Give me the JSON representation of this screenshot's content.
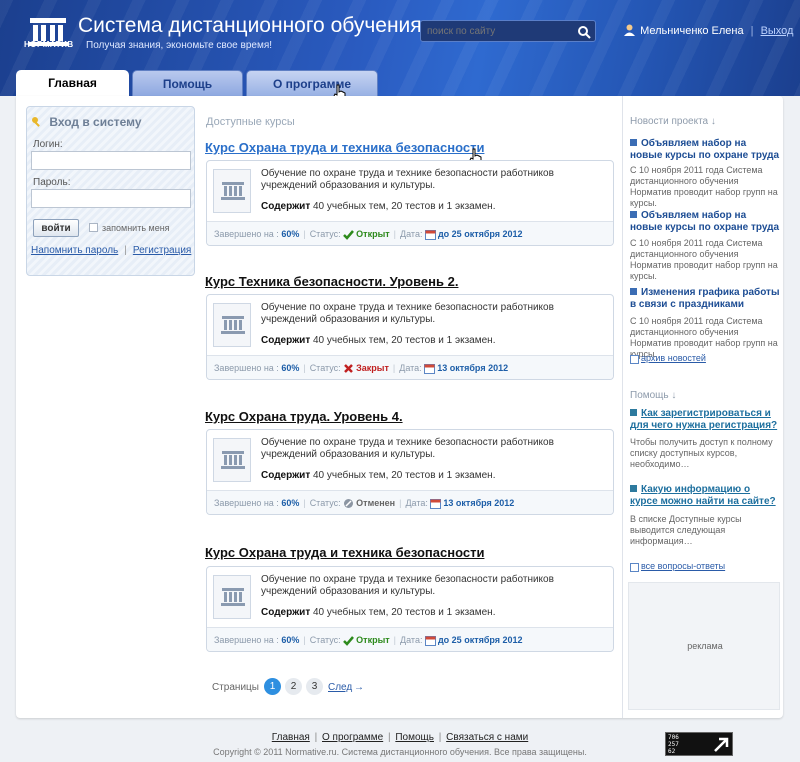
{
  "header": {
    "logo_text": "НОРМАТИВ",
    "title": "Система дистанционного обучения",
    "subtitle": "Получая знания, экономьте свое время!",
    "search_placeholder": "поиск по сайту",
    "user_name": "Мельниченко Елена",
    "logout": "Выход"
  },
  "tabs": [
    {
      "label": "Главная",
      "active": true
    },
    {
      "label": "Помощь",
      "active": false
    },
    {
      "label": "О программе",
      "active": false
    }
  ],
  "login": {
    "title": "Вход в систему",
    "login_label": "Логин:",
    "login_value": "",
    "password_label": "Пароль:",
    "password_value": "",
    "submit": "войти",
    "remember": "запомнить меня",
    "remind_password": "Напомнить пароль",
    "register": "Регистрация"
  },
  "courses_section_title": "Доступные курсы",
  "course_labels": {
    "content_label": "Содержит",
    "completed_label": "Завершено на :",
    "status_label": "Статус:",
    "date_label": "Дата:"
  },
  "courses": [
    {
      "title": "Курс Охрана труда и техника безопасности",
      "description": "Обучение по охране труда и технике безопасности работников учреждений образования и культуры.",
      "contents": "40 учебных тем, 20 тестов и 1 экзамен.",
      "completed": "60%",
      "status": "Открыт",
      "date": "до 25 октября 2012"
    },
    {
      "title": "Курс Техника безопасности. Уровень 2.",
      "description": "Обучение по охране труда и технике безопасности работников учреждений образования и культуры.",
      "contents": "40 учебных тем, 20 тестов и 1 экзамен.",
      "completed": "60%",
      "status": "Закрыт",
      "date": "13 октября 2012"
    },
    {
      "title": "Курс Охрана труда. Уровень 4.",
      "description": "Обучение по охране труда и технике безопасности работников учреждений образования и культуры.",
      "contents": "40 учебных тем, 20 тестов и 1 экзамен.",
      "completed": "60%",
      "status": "Отменен",
      "date": "13 октября 2012"
    },
    {
      "title": "Курс Охрана труда и техника безопасности",
      "description": "Обучение по охране труда и технике безопасности работников учреждений образования и культуры.",
      "contents": "40 учебных тем, 20 тестов и 1 экзамен.",
      "completed": "60%",
      "status": "Открыт",
      "date": "до 25 октября 2012"
    }
  ],
  "pagination": {
    "label": "Страницы",
    "pages": [
      "1",
      "2",
      "3"
    ],
    "current": "1",
    "next": "След",
    "next_arrow": "→"
  },
  "news": {
    "heading": "Новости проекта ↓",
    "items": [
      {
        "title": "Объявляем набор на новые курсы по охране труда",
        "text": "С 10 ноября 2011 года Система дистанционного обучения Норматив проводит набор групп на курсы."
      },
      {
        "title": "Объявляем набор на новые курсы по охране труда",
        "text": "С 10 ноября 2011 года Система дистанционного обучения Норматив проводит набор групп на курсы."
      },
      {
        "title": "Изменения графика работы в связи с праздниками",
        "text": "С 10 ноября 2011 года Система дистанционного обучения Норматив проводит набор групп на курсы."
      }
    ],
    "archive": "архив новостей"
  },
  "help": {
    "heading": "Помощь ↓",
    "items": [
      {
        "title": "Как зарегистрироваться и для чего нужна регистрация?",
        "text": "Чтобы получить доступ к полному списку доступных курсов, необходимо…"
      },
      {
        "title": "Какую информацию о курсе можно найти на сайте?",
        "text": "В списке Доступные курсы выводится следующая информация…"
      }
    ],
    "all_faq": "все вопросы-ответы"
  },
  "ad_label": "реклама",
  "footer": {
    "links": [
      "Главная",
      "О программе",
      "Помощь",
      "Связаться с нами"
    ],
    "copyright": "Copyright © 2011 Normative.ru. Система дистанционного обучения. Все права защищены."
  },
  "counter": {
    "line1": "706",
    "line2": "257",
    "line3": "62"
  },
  "colors": {
    "accent": "#2a6fc9",
    "header": "#2456b4",
    "open": "#2d8a1c",
    "closed": "#c02020"
  }
}
